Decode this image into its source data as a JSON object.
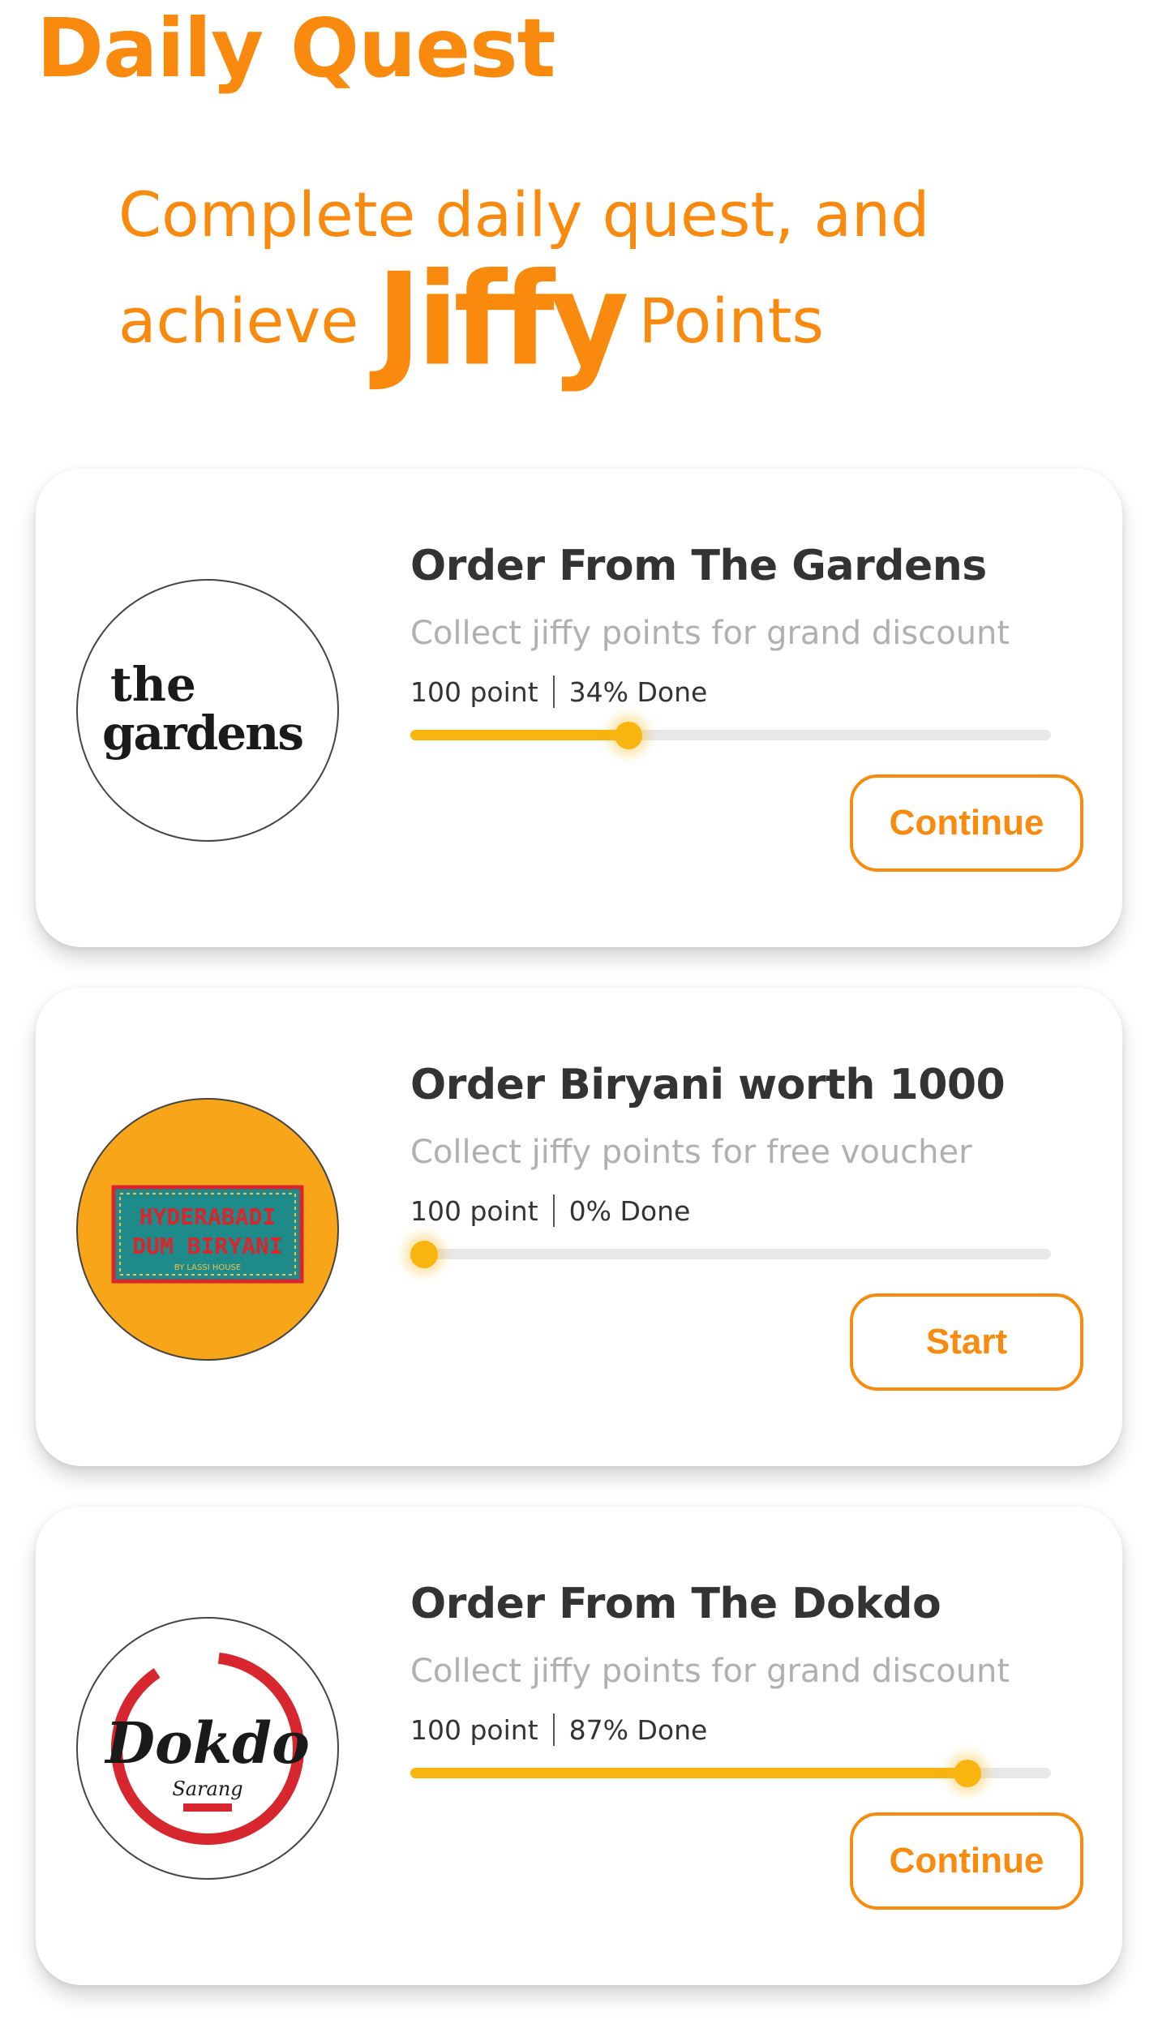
{
  "header": {
    "title": "Daily Quest"
  },
  "hero": {
    "line1": "Complete daily quest, and",
    "line2_before": "achieve",
    "brand": "Jiffy",
    "line2_after": "Points"
  },
  "quests": [
    {
      "title": "Order From The Gardens",
      "subtitle": "Collect jiffy points for grand discount",
      "points": "100 point",
      "progress_text": "34% Done",
      "progress": 0.34,
      "button": "Continue",
      "logo": {
        "name": "the-gardens-logo",
        "line1": "the",
        "line2": "gardens"
      }
    },
    {
      "title": "Order Biryani worth 1000",
      "subtitle": "Collect jiffy points for free voucher",
      "points": "100 point",
      "progress_text": "0% Done",
      "progress": 0.0,
      "button": "Start",
      "logo": {
        "name": "hyderabadi-dum-biryani-logo",
        "line1": "HYDERABADI",
        "line2": "DUM BIRYANI",
        "line3": "BY LASSI HOUSE"
      }
    },
    {
      "title": "Order From The Dokdo",
      "subtitle": "Collect jiffy points for grand discount",
      "points": "100 point",
      "progress_text": "87% Done",
      "progress": 0.87,
      "button": "Continue",
      "logo": {
        "name": "dokdo-sarang-logo",
        "line1": "Dokdo",
        "line2": "Sarang"
      }
    }
  ],
  "colors": {
    "accent": "#F98A0D",
    "progress": "#F9B410",
    "track": "#E8E8E8",
    "title_text": "#333333",
    "subtitle_text": "#B0B0B0",
    "biryani_bg": "#F8A51A",
    "biryani_badge": "#1E8B8A",
    "dokdo_red": "#D8262E"
  }
}
